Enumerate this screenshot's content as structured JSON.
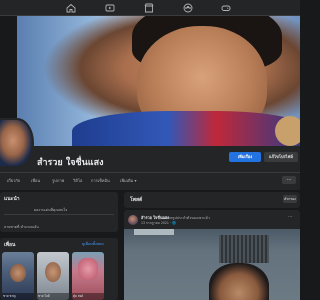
{
  "topnav": {
    "icons": [
      "home-icon",
      "video-icon",
      "marketplace-icon",
      "groups-icon",
      "gaming-icon"
    ]
  },
  "profile": {
    "name": "สำรวย ใจชื่นแสง",
    "add_story_label": "เพิ่มเรื่อง",
    "edit_profile_label": "แก้ไขโปรไฟล์"
  },
  "tabs": {
    "items": [
      "เกี่ยวกับ",
      "เพื่อน",
      "รูปภาพ",
      "วิดีโอ",
      "การเช็คอิน",
      "เพิ่มเติม ▾"
    ],
    "more_label": "···"
  },
  "intro": {
    "title": "แนะนำ",
    "line1": "ผลงานเด่นที่คุณสนใจ",
    "line2": "ลายพาดที่ คำเกมณอัน"
  },
  "friends": {
    "title": "เพื่อน",
    "see_all_label": "ดูเพื่อนทั้งหมด",
    "tiles": [
      {
        "name": "ชาย ชาญ"
      },
      {
        "name": "ชาย ใจดี"
      },
      {
        "name": "ตุ้ม สงค์"
      }
    ]
  },
  "posts": {
    "title": "โพสต์",
    "filter_label": "ตัวกรอง",
    "post": {
      "author": "สำรวย ใจชื่นแสง",
      "action": "อัพเดตรูปประจำตัวของเขาแล้ว",
      "time": "13 กรกฎาคม 2021 · 🌐",
      "more": "···"
    }
  },
  "colors": {
    "background": "#18191a",
    "card": "#242526",
    "primary": "#2374e1",
    "link": "#4599ff"
  }
}
